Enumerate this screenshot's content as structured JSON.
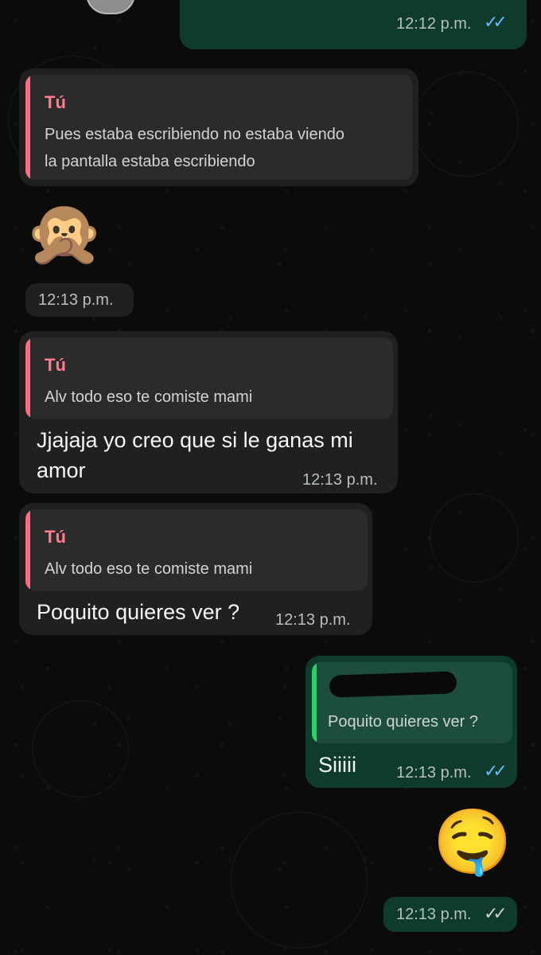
{
  "messages": [
    {
      "id": "top-outgoing",
      "time": "12:12 p.m."
    },
    {
      "id": "reply-1",
      "quote_name": "Tú",
      "quote_text_line1": "Pues estaba escribiendo no estaba viendo",
      "quote_text_line2": "la pantalla estaba escribiendo"
    },
    {
      "id": "emoji-1",
      "emoji": "🙊",
      "time": "12:13 p.m."
    },
    {
      "id": "reply-2",
      "quote_name": "Tú",
      "quote_text": "Alv todo eso te comiste mami",
      "text_line1": "Jjajaja yo creo que si le ganas mi",
      "text_line2": "amor",
      "time": "12:13 p.m."
    },
    {
      "id": "reply-3",
      "quote_name": "Tú",
      "quote_text": "Alv todo eso te comiste mami",
      "text": "Poquito quieres ver ?",
      "time": "12:13 p.m."
    },
    {
      "id": "reply-4",
      "quote_text": "Poquito quieres ver ?",
      "text": "Siiiii",
      "time": "12:13 p.m."
    },
    {
      "id": "emoji-2",
      "emoji": "🤤",
      "time": "12:13 p.m."
    }
  ],
  "icons": {
    "read_ticks": "✓✓",
    "sent_ticks": "✓✓"
  },
  "colors": {
    "incoming_bubble": "#202020",
    "outgoing_bubble": "#0f3b2a",
    "quote_pink": "#ff6b81",
    "quote_green": "#25d366",
    "read_blue": "#67b8ff"
  }
}
